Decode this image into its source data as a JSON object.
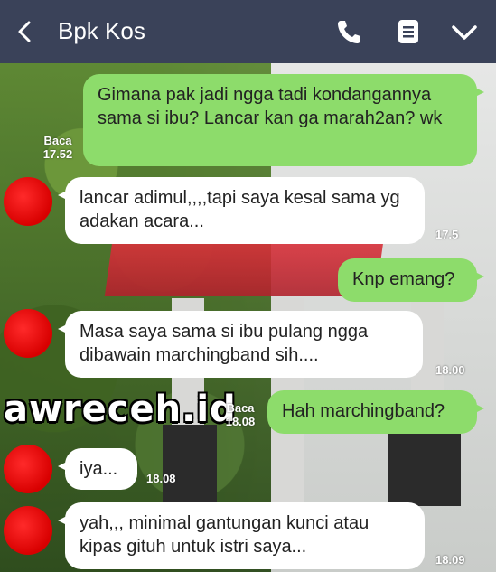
{
  "header": {
    "title": "Bpk Kos",
    "icons": [
      "back-icon",
      "phone-icon",
      "notes-icon",
      "chevron-down-icon"
    ]
  },
  "messages": [
    {
      "dir": "out",
      "text": "Gimana pak jadi ngga tadi kondangannya sama si ibu? Lancar kan ga marah2an? wk",
      "read": "Baca",
      "time": "17.52"
    },
    {
      "dir": "in",
      "text": "lancar adimul,,,,tapi saya kesal sama yg adakan acara...",
      "time": "17.5"
    },
    {
      "dir": "out",
      "text": "Knp emang?"
    },
    {
      "dir": "in",
      "text": "Masa saya sama si ibu pulang ngga dibawain marchingband sih....",
      "time": "18.00"
    },
    {
      "dir": "out",
      "text": "Hah marchingband?",
      "read": "Baca",
      "time": "18.08"
    },
    {
      "dir": "in",
      "text": "iya...",
      "time": "18.08"
    },
    {
      "dir": "in",
      "text": "yah,,, minimal gantungan kunci atau kipas gituh untuk istri saya...",
      "time": "18.09"
    }
  ],
  "watermark": "awreceh.id",
  "colors": {
    "header": "#3a4259",
    "outgoing": "#8ddc6b",
    "incoming": "#ffffff",
    "avatar": "#e01010"
  }
}
